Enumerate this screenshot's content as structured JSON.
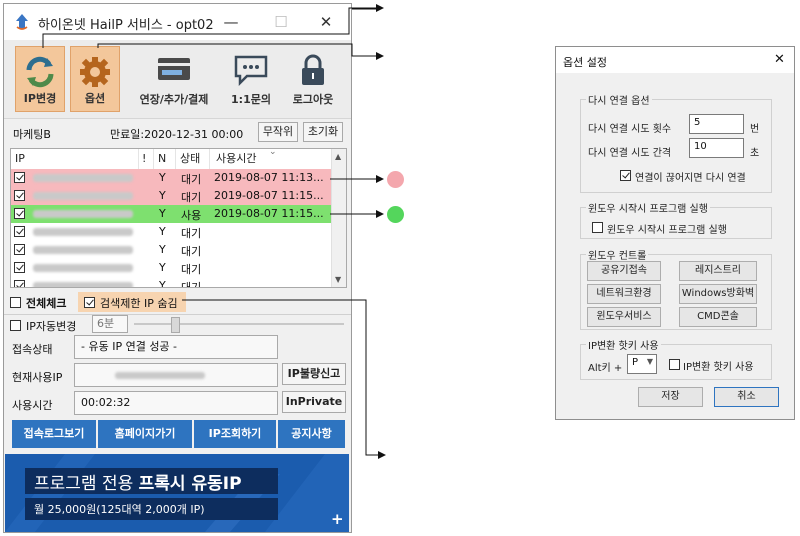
{
  "window": {
    "title": "하이온넷 HailP 서비스 - opt02",
    "minimize": "—",
    "maximize": "☐",
    "close": "✕"
  },
  "toolbar": {
    "buttons": [
      {
        "label": "IP변경",
        "icon": "refresh-icon"
      },
      {
        "label": "옵션",
        "icon": "gear-icon"
      },
      {
        "label": "연장/추가/결제",
        "icon": "card-icon"
      },
      {
        "label": "1:1문의",
        "icon": "chat-icon"
      },
      {
        "label": "로그아웃",
        "icon": "lock-icon"
      }
    ]
  },
  "info": {
    "user": "마케팅B",
    "expiry": "만료일:2020-12-31 00:00",
    "random_btn": "무작위",
    "reset_btn": "초기화"
  },
  "list": {
    "headers": {
      "ip": "IP",
      "excl": "!",
      "n": "N",
      "status": "상태",
      "time": "사용시간"
    },
    "rows": [
      {
        "n": "Y",
        "status": "대기",
        "time": "2019-08-07 11:13...",
        "bg": "#f7b9bd"
      },
      {
        "n": "Y",
        "status": "대기",
        "time": "2019-08-07 11:15...",
        "bg": "#f7b9bd"
      },
      {
        "n": "Y",
        "status": "사용",
        "time": "2019-08-07 11:15...",
        "bg": "#7ee06f"
      },
      {
        "n": "Y",
        "status": "대기",
        "time": "",
        "bg": "#ffffff"
      },
      {
        "n": "Y",
        "status": "대기",
        "time": "",
        "bg": "#ffffff"
      },
      {
        "n": "Y",
        "status": "대기",
        "time": "",
        "bg": "#ffffff"
      },
      {
        "n": "Y",
        "status": "대기",
        "time": "",
        "bg": "#ffffff"
      }
    ]
  },
  "options": {
    "check_all": "전체체크",
    "hide_restricted": "검색제한 IP 숨김",
    "auto_change": "IP자동변경",
    "interval": "6분"
  },
  "status": {
    "conn_label": "접속상태",
    "conn_value": "- 유동 IP 연결 성공 -",
    "current_ip_label": "현재사용IP",
    "report_btn": "IP불량신고",
    "usetime_label": "사용시간",
    "usetime_value": "00:02:32",
    "inprivate_btn": "InPrivate"
  },
  "bottom_buttons": [
    "접속로그보기",
    "홈페이지가기",
    "IP조회하기",
    "공지사항"
  ],
  "banner": {
    "line1_prefix": "프로그램 전용 ",
    "line1_bold": "프록시 유동IP",
    "line2": "월 25,000원(125대역 2,000개 IP)",
    "plus": "+"
  },
  "dialog": {
    "title": "옵션 설정",
    "close": "✕",
    "reconnect": {
      "title": "다시 연결 옵션",
      "retry_count_label": "다시 연결 시도 횟수",
      "retry_count_value": "5",
      "retry_count_unit": "번",
      "retry_interval_label": "다시 연결 시도 간격",
      "retry_interval_value": "10",
      "retry_interval_unit": "초",
      "reconnect_on_drop": "연결이 끊어지면 다시 연결"
    },
    "startup": {
      "title": "윈도우 시작시 프로그램 실행",
      "checkbox": "윈도우 시작시 프로그램 실행"
    },
    "controls": {
      "title": "윈도우 컨트롤",
      "buttons": [
        "공유기접속",
        "레지스트리",
        "네트워크환경",
        "Windows방화벽",
        "윈도우서비스",
        "CMD콘솔"
      ]
    },
    "hotkey": {
      "title": "IP변환 핫키 사용",
      "prefix": "Alt키 +",
      "key": "P",
      "checkbox": "IP변환 핫키 사용"
    },
    "ok": "저장",
    "cancel": "취소"
  },
  "colors": {
    "marker_red": "#f4a7ad",
    "marker_green": "#54d65c",
    "accent_blue": "#2e74c0",
    "active_tab": "#f3c79b"
  }
}
